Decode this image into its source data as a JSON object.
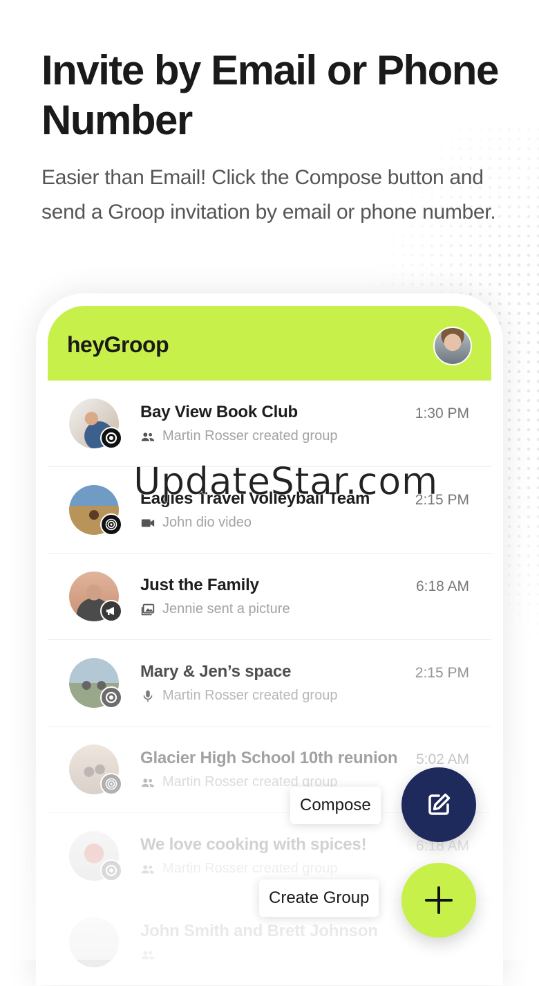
{
  "headline": "Invite by Email or Phone Number",
  "subtext": "Easier than Email! Click the Compose button and send a Groop invitation by email or phone number.",
  "app": {
    "title": "heyGroop",
    "profile_avatar": "user-avatar"
  },
  "groups": [
    {
      "title": "Bay View Book Club",
      "time": "1:30 PM",
      "subtitle": "Martin Rosser created group",
      "sub_icon": "people-icon",
      "badge_icon": "target-icon"
    },
    {
      "title": "Eagles Travel Volleyball Team",
      "time": "2:15 PM",
      "subtitle": "John dio video",
      "sub_icon": "video-icon",
      "badge_icon": "bullseye-icon"
    },
    {
      "title": "Just the Family",
      "time": "6:18 AM",
      "subtitle": "Jennie sent a picture",
      "sub_icon": "picture-icon",
      "badge_icon": "megaphone-icon"
    },
    {
      "title": "Mary & Jen’s space",
      "time": "2:15 PM",
      "subtitle": "Martin Rosser created group",
      "sub_icon": "microphone-icon",
      "badge_icon": "target-icon"
    },
    {
      "title": "Glacier High School 10th reunion",
      "time": "5:02 AM",
      "subtitle": "Martin Rosser created group",
      "sub_icon": "people-icon",
      "badge_icon": "bullseye-icon"
    },
    {
      "title": "We love cooking with spices!",
      "time": "6:18 AM",
      "subtitle": "Martin Rosser created group",
      "sub_icon": "people-icon",
      "badge_icon": "target-icon"
    },
    {
      "title": "John Smith and Brett Johnson",
      "time": "",
      "subtitle": "",
      "sub_icon": "people-icon",
      "badge_icon": ""
    }
  ],
  "fab": {
    "compose_label": "Compose",
    "create_group_label": "Create Group",
    "compose_icon": "edit-icon",
    "create_icon": "plus-icon",
    "compose_color": "#1f2a5c",
    "create_color": "#c8f04a"
  },
  "watermark": "UpdateStar.com",
  "colors": {
    "accent": "#c8f04a",
    "navy": "#1f2a5c",
    "headline": "#1a1a1a"
  }
}
